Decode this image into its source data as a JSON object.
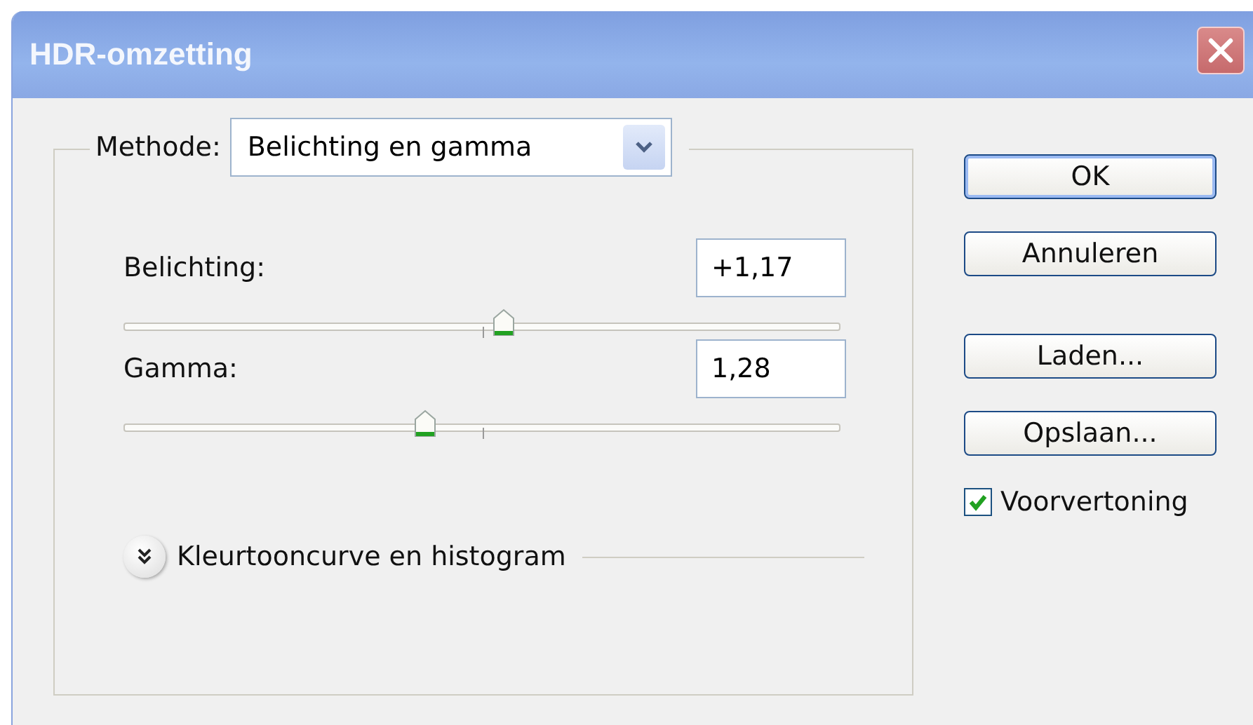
{
  "window": {
    "title": "HDR-omzetting"
  },
  "method": {
    "label": "Methode:",
    "value": "Belichting en gamma"
  },
  "sliders": [
    {
      "label": "Belichting:",
      "value": "+1,17",
      "level": 0.53
    },
    {
      "label": "Gamma:",
      "value": "1,28",
      "level": 0.42
    }
  ],
  "expander": {
    "label": "Kleurtooncurve en histogram",
    "expanded": false
  },
  "buttons": [
    {
      "label": "OK",
      "default": true
    },
    {
      "label": "Annuleren",
      "default": false
    },
    {
      "label": "Laden...",
      "default": false
    },
    {
      "label": "Opslaan...",
      "default": false
    }
  ],
  "preview": {
    "label": "Voorvertoning",
    "checked": true
  }
}
